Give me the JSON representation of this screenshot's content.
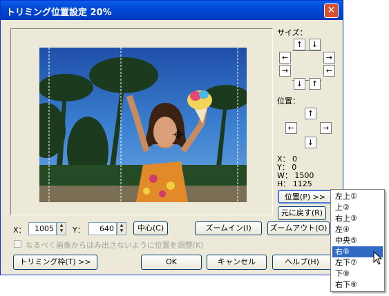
{
  "window": {
    "title": "トリミング位置設定 20%",
    "close": "✕"
  },
  "size_panel": {
    "label": "サイズ："
  },
  "position_panel": {
    "label": "位置："
  },
  "readout": {
    "x": "X：  0",
    "y": "Y：  0",
    "w": "W：  1500",
    "h": "H：  1125"
  },
  "buttons": {
    "position": "位置(P) >>",
    "reset": "元に戻す(R)",
    "center": "中心(C)",
    "zoom_in": "ズームイン(I)",
    "zoom_out": "ズームアウト(O)",
    "trim_frame": "トリミング枠(T) >>",
    "ok": "OK",
    "cancel": "キャンセル",
    "help": "ヘルプ(H)"
  },
  "fields": {
    "x_label": "X：",
    "x_value": "1005",
    "y_label": "Y：",
    "y_value": "640"
  },
  "checkbox": {
    "label": "なるべく画像からはみ出さないように位置を調整(K)",
    "checked": false
  },
  "dropdown": {
    "items": [
      "左上①",
      "上②",
      "右上③",
      "左④",
      "中央⑤",
      "右⑥",
      "左下⑦",
      "下⑧",
      "右下⑨"
    ],
    "selected_index": 5
  },
  "colors": {
    "titlebar": "#0047d6",
    "menu_highlight": "#316ac5",
    "dialog": "#ece9d8"
  }
}
